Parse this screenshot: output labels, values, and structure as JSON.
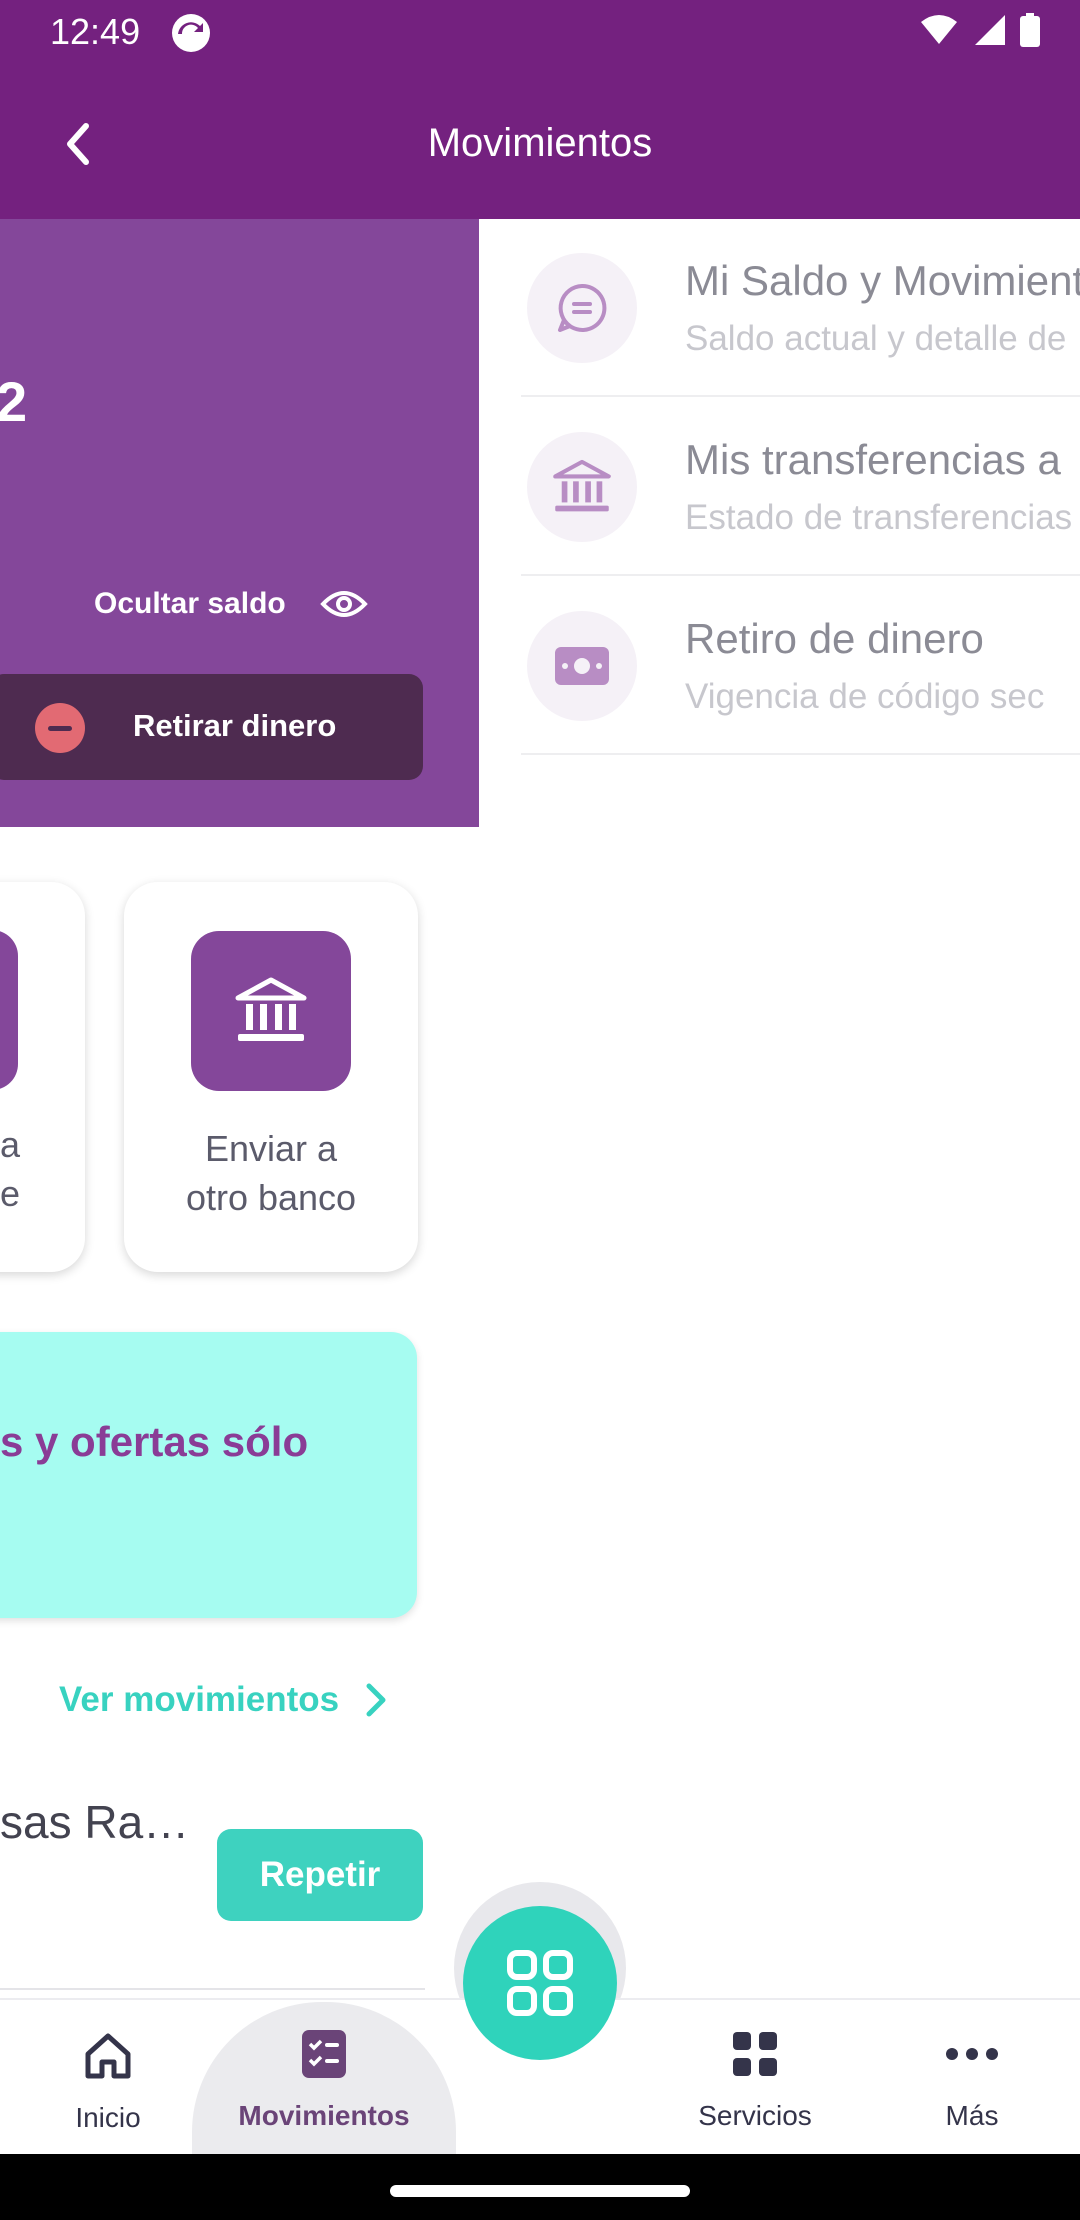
{
  "status_bar": {
    "time": "12:49"
  },
  "header": {
    "title": "Movimientos"
  },
  "balance_card": {
    "partial_value": "2",
    "hide_label": "Ocultar saldo",
    "withdraw_label": "Retirar dinero"
  },
  "actions": {
    "left_card_fragments": [
      "a",
      "e"
    ],
    "bank_transfer_label": "Enviar a otro banco"
  },
  "promo": {
    "text": "s y ofertas sólo"
  },
  "recent": {
    "see_movements": "Ver movimientos",
    "transaction_name": "sas Ra…",
    "repeat_label": "Repetir"
  },
  "menu": {
    "items": [
      {
        "title": "Mi Saldo y Movimientos",
        "subtitle": "Saldo actual y detalle de",
        "icon": "chat-icon"
      },
      {
        "title": "Mis transferencias a",
        "subtitle": "Estado de transferencias",
        "icon": "bank-icon"
      },
      {
        "title": "Retiro de dinero",
        "subtitle": "Vigencia de código sec",
        "icon": "cash-icon"
      }
    ]
  },
  "bottom_nav": {
    "items": [
      {
        "label": "Inicio",
        "icon": "home-icon"
      },
      {
        "label": "Movimientos",
        "icon": "checklist-icon",
        "active": true
      },
      {
        "label": "Servicios",
        "icon": "grid-icon"
      },
      {
        "label": "Más",
        "icon": "more-icon"
      }
    ],
    "fab_icon": "apps-icon"
  },
  "colors": {
    "header": "#74217f",
    "card_purple": "#84479a",
    "accent_teal": "#3ed2bf",
    "promo_bg": "#a6fcf1"
  }
}
